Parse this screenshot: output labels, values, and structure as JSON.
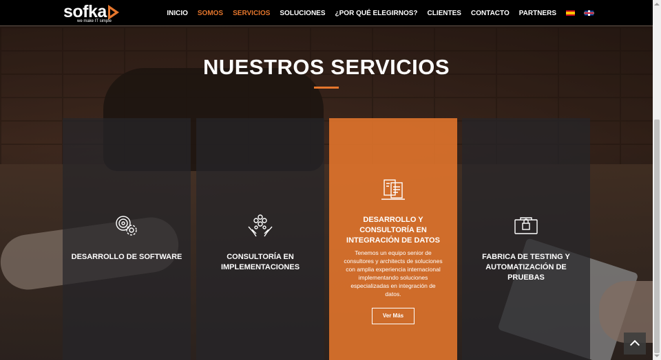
{
  "logo": {
    "word": "sofka",
    "tagline": "we make IT simple"
  },
  "nav": {
    "items": [
      "INICIO",
      "SOMOS",
      "SERVICIOS",
      "SOLUCIONES",
      "¿POR QUÉ ELEGIRNOS?",
      "CLIENTES",
      "CONTACTO",
      "PARTNERS"
    ],
    "highlighted": [
      "SOMOS",
      "SERVICIOS"
    ],
    "languages": [
      "es-flag-icon",
      "uk-flag-icon"
    ]
  },
  "section": {
    "title": "NUESTROS SERVICIOS"
  },
  "cards": [
    {
      "title": "DESARROLLO DE SOFTWARE",
      "icon": "gears-icon"
    },
    {
      "title": "CONSULTORÍA EN IMPLEMENTACIONES",
      "icon": "hands-network-icon"
    },
    {
      "title": "DESARROLLO Y CONSULTORÍA EN INTEGRACIÓN DE DATOS",
      "icon": "documents-icon",
      "description": "Tenemos un equipo senior de consultores y architects de soluciones con amplia experiencia internacional implementando soluciones especializadas en integración de datos.",
      "button": "Ver Más"
    },
    {
      "title": "FABRICA DE TESTING Y AUTOMATIZACIÓN DE PRUEBAS",
      "icon": "testing-lock-icon"
    }
  ],
  "colors": {
    "accent": "#e5762c",
    "nav_bg": "#000000",
    "card_bg": "#26262a"
  }
}
